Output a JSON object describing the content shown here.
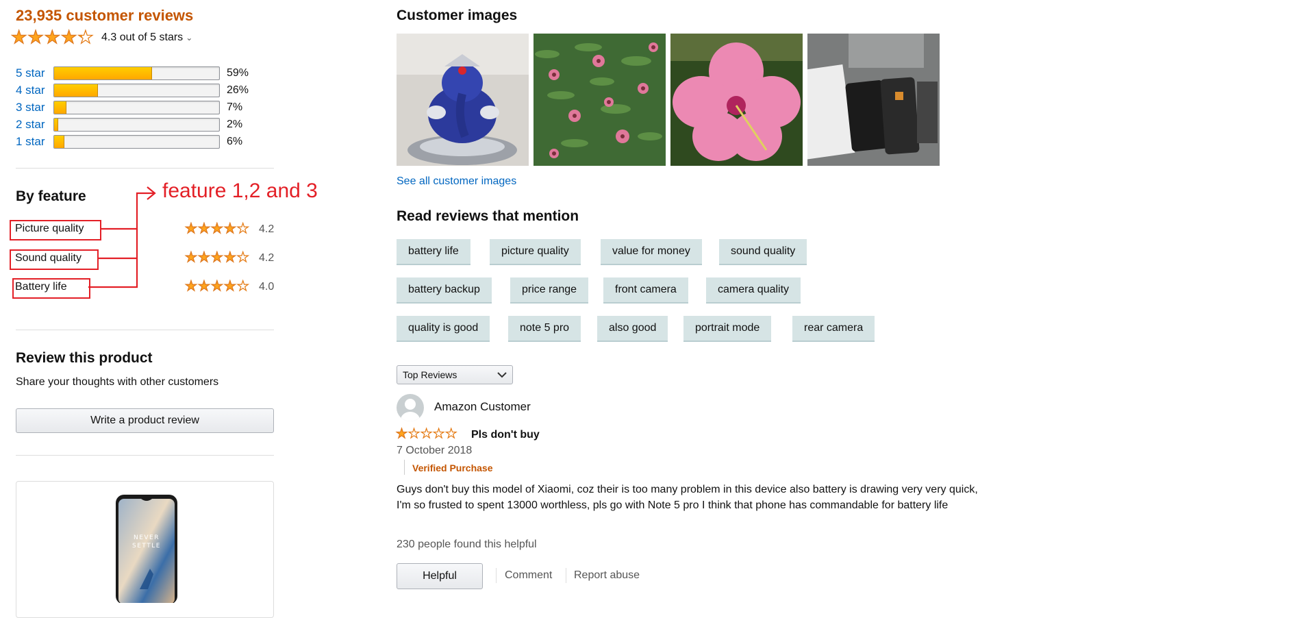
{
  "summary": {
    "reviews_count": "23,935 customer reviews",
    "overall_rating_text": "4.3 out of 5 stars",
    "overall_rating": 4.3
  },
  "histogram": [
    {
      "label": "5 star",
      "pct_text": "59%",
      "pct": 59
    },
    {
      "label": "4 star",
      "pct_text": "26%",
      "pct": 26
    },
    {
      "label": "3 star",
      "pct_text": "7%",
      "pct": 7
    },
    {
      "label": "2 star",
      "pct_text": "2%",
      "pct": 2
    },
    {
      "label": "1 star",
      "pct_text": "6%",
      "pct": 6
    }
  ],
  "by_feature": {
    "title": "By feature",
    "annotation": "feature 1,2 and 3",
    "items": [
      {
        "label": "Picture quality",
        "rating_text": "4.2",
        "rating": 4.2
      },
      {
        "label": "Sound quality",
        "rating_text": "4.2",
        "rating": 4.2
      },
      {
        "label": "Battery life",
        "rating_text": "4.0",
        "rating": 4.0
      }
    ]
  },
  "review_product": {
    "title": "Review this product",
    "subtitle": "Share your thoughts with other customers",
    "button": "Write a product review"
  },
  "product_card": {
    "phone_text": "NEVER SETTLE"
  },
  "customer_images": {
    "title": "Customer images",
    "see_all": "See all customer images"
  },
  "mentions": {
    "title": "Read reviews that mention",
    "rows": [
      [
        "battery life",
        "picture quality",
        "value for money",
        "sound quality"
      ],
      [
        "battery backup",
        "price range",
        "front camera",
        "camera quality"
      ],
      [
        "quality is good",
        "note 5 pro",
        "also good",
        "portrait mode",
        "rear camera"
      ]
    ]
  },
  "sort": {
    "selected": "Top Reviews"
  },
  "review": {
    "reviewer": "Amazon Customer",
    "rating": 1,
    "title": "Pls don't buy",
    "date": "7 October 2018",
    "verified": "Verified Purchase",
    "body": "Guys don't buy this model of Xiaomi, coz their is too many problem in this device also battery is drawing very very quick, I'm so frusted to spent 13000 worthless, pls go with Note 5 pro I think that phone has commandable for battery life",
    "helpful_count": "230 people found this helpful",
    "helpful_button": "Helpful",
    "comment": "Comment",
    "report": "Report abuse"
  },
  "colors": {
    "accent_orange": "#c45500",
    "link_blue": "#0066c0",
    "star_gold": "#ffa41c",
    "annotation_red": "#e31f26",
    "chip_bg": "#d6e4e5"
  }
}
